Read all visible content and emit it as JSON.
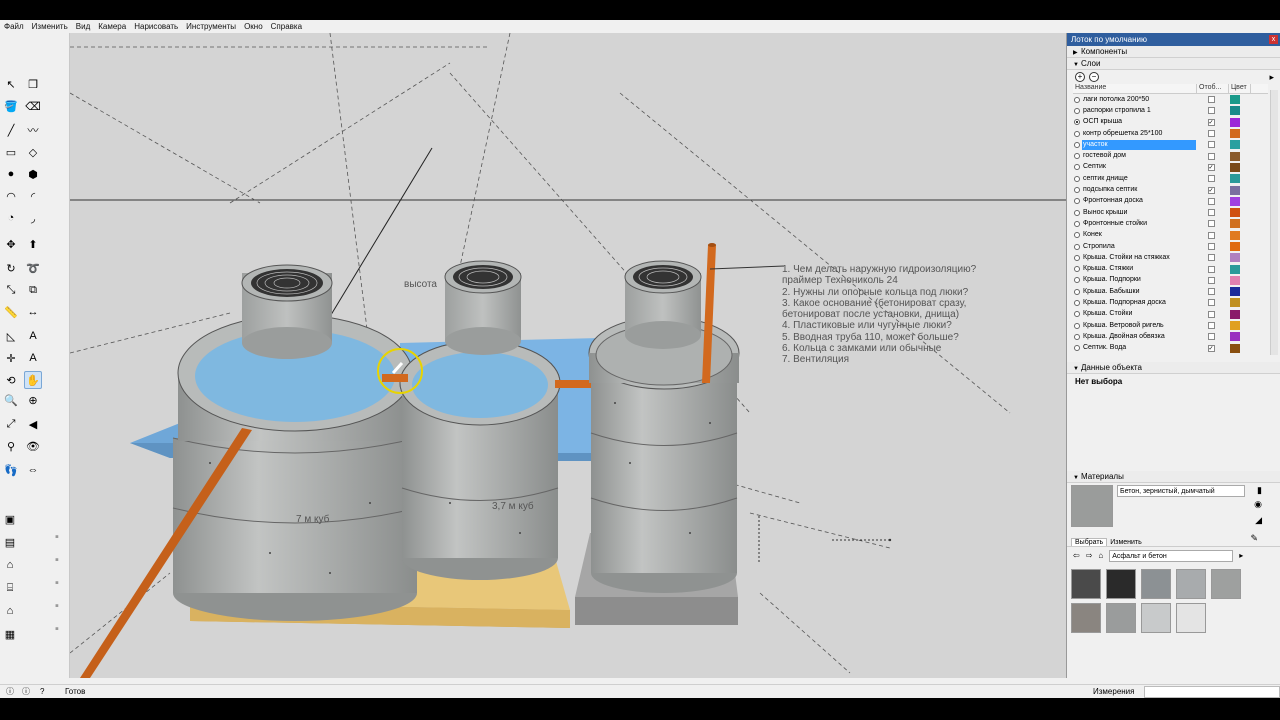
{
  "menu": [
    "Файл",
    "Изменить",
    "Вид",
    "Камера",
    "Нарисовать",
    "Инструменты",
    "Окно",
    "Справка"
  ],
  "tools": [
    {
      "name": "select-tool-icon",
      "glyph": "↖"
    },
    {
      "name": "component-tool-icon",
      "glyph": "❒"
    },
    {
      "name": "paint-bucket-icon",
      "glyph": "🪣"
    },
    {
      "name": "eraser-icon",
      "glyph": "⌫"
    },
    {
      "name": "line-tool-icon",
      "glyph": "╱"
    },
    {
      "name": "freehand-icon",
      "glyph": "〰"
    },
    {
      "name": "rectangle-tool-icon",
      "glyph": "▭"
    },
    {
      "name": "rotated-rectangle-icon",
      "glyph": "◇"
    },
    {
      "name": "circle-tool-icon",
      "glyph": "●"
    },
    {
      "name": "polygon-tool-icon",
      "glyph": "⬢"
    },
    {
      "name": "arc-tool-icon",
      "glyph": "◠"
    },
    {
      "name": "arc-2pt-icon",
      "glyph": "◜"
    },
    {
      "name": "pie-tool-icon",
      "glyph": "◔"
    },
    {
      "name": "arc-3pt-icon",
      "glyph": "◞"
    },
    {
      "name": "move-tool-icon",
      "glyph": "✥"
    },
    {
      "name": "push-pull-icon",
      "glyph": "⬆"
    },
    {
      "name": "rotate-tool-icon",
      "glyph": "↻"
    },
    {
      "name": "follow-me-icon",
      "glyph": "➰"
    },
    {
      "name": "scale-tool-icon",
      "glyph": "⤡"
    },
    {
      "name": "offset-tool-icon",
      "glyph": "⧉"
    },
    {
      "name": "tape-measure-icon",
      "glyph": "📏"
    },
    {
      "name": "dimension-tool-icon",
      "glyph": "↔"
    },
    {
      "name": "protractor-icon",
      "glyph": "◺"
    },
    {
      "name": "text-tool-icon",
      "glyph": "A"
    },
    {
      "name": "axes-tool-icon",
      "glyph": "✛"
    },
    {
      "name": "3d-text-icon",
      "glyph": "A"
    },
    {
      "name": "orbit-tool-icon",
      "glyph": "⟲"
    },
    {
      "name": "pan-tool-icon",
      "glyph": "✋"
    },
    {
      "name": "zoom-tool-icon",
      "glyph": "🔍"
    },
    {
      "name": "zoom-window-icon",
      "glyph": "⊕"
    },
    {
      "name": "zoom-extents-icon",
      "glyph": "⤢"
    },
    {
      "name": "previous-view-icon",
      "glyph": "◀"
    },
    {
      "name": "position-camera-icon",
      "glyph": "⚲"
    },
    {
      "name": "look-around-icon",
      "glyph": "👁"
    },
    {
      "name": "walk-tool-icon",
      "glyph": "👣"
    },
    {
      "name": "section-plane-icon",
      "glyph": "⇔"
    }
  ],
  "toolbar2": [
    {
      "name": "warehouse-icon",
      "glyph": "▣"
    },
    {
      "name": "extension-icon",
      "glyph": "▤"
    },
    {
      "name": "home-view-icon",
      "glyph": "⌂"
    },
    {
      "name": "share-model-icon",
      "glyph": "⌸"
    },
    {
      "name": "house-icon",
      "glyph": "⌂"
    },
    {
      "name": "layout-icon",
      "glyph": "▦"
    }
  ],
  "viewport": {
    "labels": {
      "height_label": "высота",
      "vol1": "7 м куб",
      "vol2": "3,7 м куб"
    },
    "notes": [
      "1. Чем делать наружную гидроизоляцию?",
      "праймер Технониколь 24",
      "2. Нужны ли опорные кольца под люки?",
      "3. Какое основание (бетонироват сразу,",
      "бетонироват после установки, днища)",
      "4. Пластиковые или чугунные люки?",
      "5. Вводная труба 110, может больше?",
      "6. Кольца с замками или обычные",
      "7. Вентиляция"
    ],
    "colors": {
      "background": "#d4d4d4",
      "concrete": "#a9acab",
      "water": "#7fb8e0",
      "slab": "#7cb4e4",
      "pipe": "#d2691e",
      "wood": "#e8c779",
      "gravel": "#9a9a9a"
    }
  },
  "panel": {
    "title": "Лоток по умолчанию",
    "close": "x",
    "sections": {
      "components": "Компоненты",
      "layers": "Слои",
      "entity_info": "Данные объекта",
      "materials": "Материалы"
    },
    "layer_columns": {
      "name": "Название",
      "visible": "Отоб...",
      "color": "Цвет"
    },
    "layers": [
      {
        "name": "лаги потолка 200*50",
        "visible": false,
        "color": "#1a9a8a",
        "active": false
      },
      {
        "name": "распорки стропила 1",
        "visible": false,
        "color": "#1a8a8a",
        "active": false
      },
      {
        "name": "ОСП крыша",
        "visible": true,
        "color": "#9c27d8",
        "active": true
      },
      {
        "name": "контр обрешетка 25*100",
        "visible": false,
        "color": "#d2691e",
        "active": false
      },
      {
        "name": "участок",
        "visible": false,
        "color": "#2aa0a0",
        "active": false,
        "selected": true
      },
      {
        "name": "гостевой дом",
        "visible": false,
        "color": "#8a5a2a",
        "active": false
      },
      {
        "name": "Септик",
        "visible": true,
        "color": "#7a4a1a",
        "active": false
      },
      {
        "name": "септик днище",
        "visible": false,
        "color": "#2a9a9a",
        "active": false
      },
      {
        "name": "подсыпка септик",
        "visible": true,
        "color": "#7a6fa0",
        "active": false
      },
      {
        "name": "Фронтонная доска",
        "visible": false,
        "color": "#a040e0",
        "active": false
      },
      {
        "name": "Вынос крыши",
        "visible": false,
        "color": "#d05010",
        "active": false
      },
      {
        "name": "Фронтонные стойки",
        "visible": false,
        "color": "#d07020",
        "active": false
      },
      {
        "name": "Конек",
        "visible": false,
        "color": "#e07a20",
        "active": false
      },
      {
        "name": "Стропила",
        "visible": false,
        "color": "#e06a10",
        "active": false
      },
      {
        "name": "Крыша. Стойки на стяжках",
        "visible": false,
        "color": "#b080c0",
        "active": false
      },
      {
        "name": "Крыша. Стяжки",
        "visible": false,
        "color": "#2a9a9a",
        "active": false
      },
      {
        "name": "Крыша. Подпорки",
        "visible": false,
        "color": "#e080b0",
        "active": false
      },
      {
        "name": "Крыша. Бабышки",
        "visible": false,
        "color": "#1a2a9a",
        "active": false
      },
      {
        "name": "Крыша. Подпорная доска",
        "visible": false,
        "color": "#c09020",
        "active": false
      },
      {
        "name": "Крыша. Стойки",
        "visible": false,
        "color": "#8a1a6a",
        "active": false
      },
      {
        "name": "Крыша. Ветровой ригель",
        "visible": false,
        "color": "#e0a020",
        "active": false
      },
      {
        "name": "Крыша. Двойная обвязка",
        "visible": false,
        "color": "#9a30c0",
        "active": false
      },
      {
        "name": "Септик. Вода",
        "visible": true,
        "color": "#8a5010",
        "active": false
      }
    ],
    "entity_info_text": "Нет выбора",
    "material_name": "Бетон, зернистый, дымчатый",
    "material_tabs": [
      "Выбрать",
      "Изменить"
    ],
    "material_library": "Асфальт и бетон",
    "material_swatches": [
      "#4a4a4a",
      "#2a2a2a",
      "#8c9194",
      "#a8abad",
      "#9ea09f",
      "#8a8580",
      "#9a9c9c",
      "#c8cacb",
      "#e4e4e4"
    ]
  },
  "status": {
    "ready": "Готов",
    "measure": "Измерения"
  }
}
